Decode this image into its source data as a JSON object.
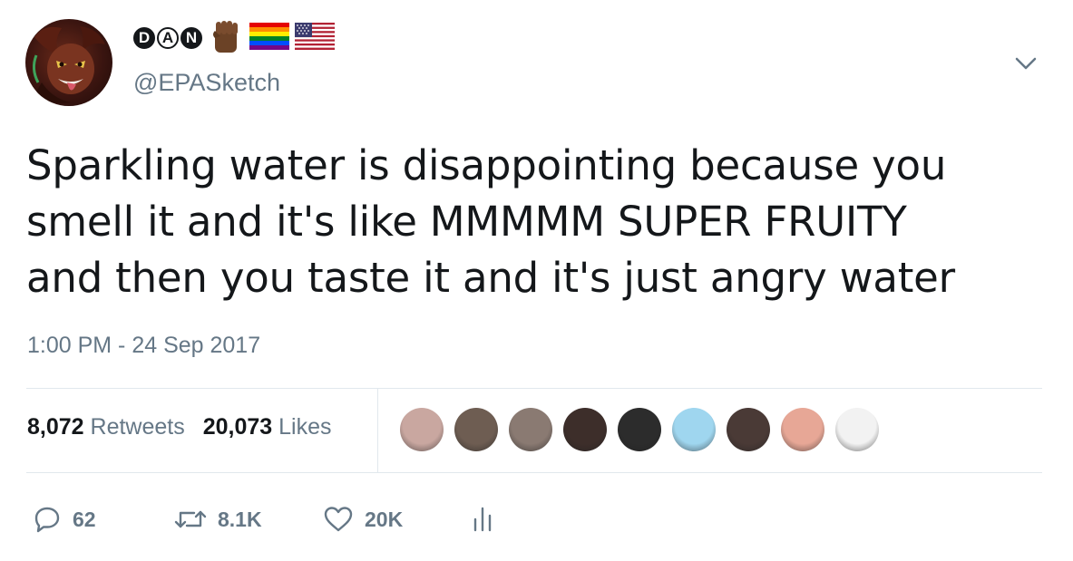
{
  "author": {
    "name_letters": [
      "D",
      "A",
      "N"
    ],
    "emoji_icons": [
      "raised-fist-icon",
      "rainbow-flag-icon",
      "us-flag-icon"
    ],
    "handle": "@EPASketch"
  },
  "tweet": {
    "text": "Sparkling water is disappointing because you\nsmell it and it's like MMMMM SUPER FRUITY\nand then you taste it and it's just angry water",
    "timestamp": "1:00 PM - 24 Sep 2017"
  },
  "stats": {
    "retweets_count": "8,072",
    "retweets_label": "Retweets",
    "likes_count": "20,073",
    "likes_label": "Likes"
  },
  "liked_by": [
    {
      "icon": "liker-avatar-icon",
      "color": "#c9a7a0"
    },
    {
      "icon": "liker-avatar-icon",
      "color": "#6e5d52"
    },
    {
      "icon": "liker-avatar-icon",
      "color": "#8a7a72"
    },
    {
      "icon": "liker-avatar-icon",
      "color": "#3d2e2a"
    },
    {
      "icon": "liker-avatar-icon",
      "color": "#2c2c2c"
    },
    {
      "icon": "liker-avatar-icon",
      "color": "#9fd6ef"
    },
    {
      "icon": "liker-avatar-icon",
      "color": "#4a3a36"
    },
    {
      "icon": "liker-avatar-icon",
      "color": "#e7a796"
    },
    {
      "icon": "liker-avatar-icon",
      "color": "#f2f2f2"
    }
  ],
  "actions": {
    "reply_count": "62",
    "retweet_count": "8.1K",
    "like_count": "20K"
  },
  "colors": {
    "text": "#14171a",
    "secondary": "#657786",
    "divider": "#e1e8ed"
  }
}
